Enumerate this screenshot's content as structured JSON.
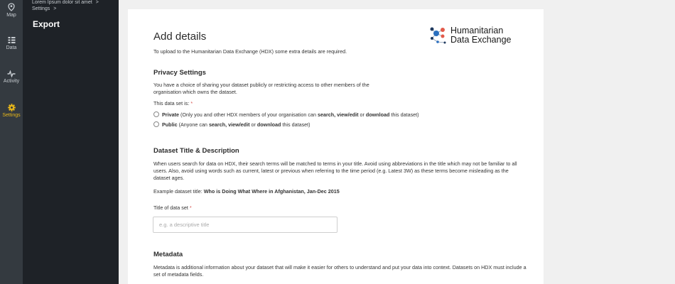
{
  "rail": {
    "items": [
      {
        "label": "Map",
        "icon": "map-pin-icon"
      },
      {
        "label": "Data",
        "icon": "data-icon"
      },
      {
        "label": "Activity",
        "icon": "activity-icon"
      },
      {
        "label": "Settings",
        "icon": "gear-icon",
        "active": true
      }
    ],
    "active_color": "#e8b71a"
  },
  "panel": {
    "breadcrumb": [
      "Lorem Ipsum dolor sit amet",
      "Settings"
    ],
    "separator": ">",
    "title": "Export"
  },
  "logo": {
    "line1": "Humanitarian",
    "line2": "Data Exchange",
    "icon": "hdx-network-logo-icon"
  },
  "page": {
    "title": "Add details",
    "subtitle": "To upload to the Humanitarian Data Exchange (HDX) some extra details are required."
  },
  "privacy": {
    "heading": "Privacy Settings",
    "description": "You have a choice of sharing your dataset publicly or restricting access to other members of the organisation which owns the dataset.",
    "question": "This data set is:",
    "required_mark": "*",
    "options": [
      {
        "bold": "Private",
        "pre": "(Only you and other HDX members of your organisation can ",
        "b1": "search, view/edit",
        "mid": " or ",
        "b2": "download",
        "post": " this dataset)"
      },
      {
        "bold": "Public",
        "pre": "(Anyone can ",
        "b1": "search, view/edit",
        "mid": " or ",
        "b2": "download",
        "post": " this dataset)"
      }
    ]
  },
  "dataset": {
    "heading": "Dataset Title & Description",
    "description": "When users search for data on HDX, their search terms will be matched to terms in your title. Avoid using abbreviations in the title which may not be familiar to all users. Also, avoid using words such as current, latest or previous when referring to the time period (e.g. Latest 3W) as these terms become misleading as the dataset ages.",
    "example_label": "Example dataset title:",
    "example_value": "Who is Doing What Where in Afghanistan, Jan-Dec 2015",
    "field_label": "Title of data set",
    "required_mark": "*",
    "placeholder": "e.g. a descriptive title"
  },
  "metadata": {
    "heading": "Metadata",
    "description": "Metadata is additional information about your dataset that will make it easier for others to understand and put your data into context. Datasets on HDX must include a set of metadata fields."
  }
}
